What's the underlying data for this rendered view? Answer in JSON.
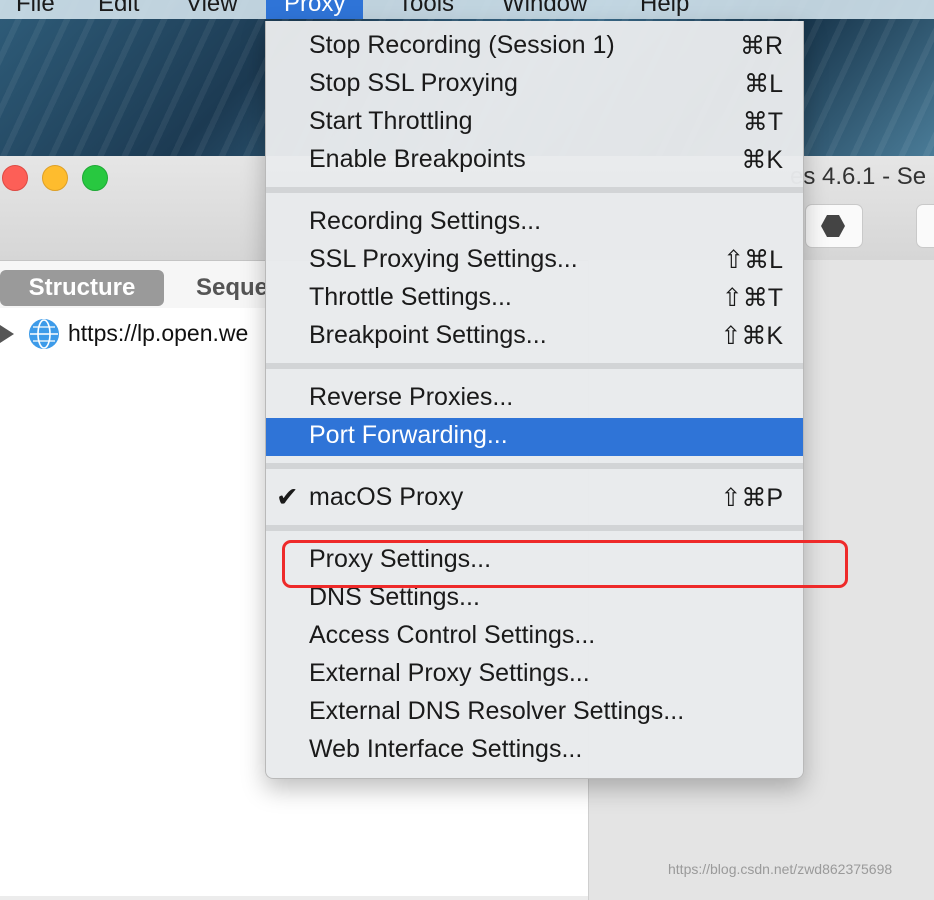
{
  "menubar": {
    "items": [
      "File",
      "Edit",
      "View",
      "Proxy",
      "Tools",
      "Window",
      "Help"
    ],
    "active": "Proxy"
  },
  "window": {
    "title": "es 4.6.1 - Se",
    "tabs": {
      "structure": "Structure",
      "sequence": "Seque"
    },
    "tree": {
      "url": "https://lp.open.we"
    }
  },
  "menu": {
    "sections": [
      [
        {
          "label": "Stop Recording (Session 1)",
          "shortcut": "⌘R"
        },
        {
          "label": "Stop SSL Proxying",
          "shortcut": "⌘L"
        },
        {
          "label": "Start Throttling",
          "shortcut": "⌘T"
        },
        {
          "label": "Enable Breakpoints",
          "shortcut": "⌘K"
        }
      ],
      [
        {
          "label": "Recording Settings...",
          "shortcut": ""
        },
        {
          "label": "SSL Proxying Settings...",
          "shortcut": "⇧⌘L"
        },
        {
          "label": "Throttle Settings...",
          "shortcut": "⇧⌘T"
        },
        {
          "label": "Breakpoint Settings...",
          "shortcut": "⇧⌘K"
        }
      ],
      [
        {
          "label": "Reverse Proxies...",
          "shortcut": ""
        },
        {
          "label": "Port Forwarding...",
          "shortcut": "",
          "highlighted": true
        }
      ],
      [
        {
          "label": "macOS Proxy",
          "shortcut": "⇧⌘P",
          "checked": true,
          "check_mark": "✔"
        }
      ],
      [
        {
          "label": "Proxy Settings...",
          "shortcut": ""
        },
        {
          "label": "DNS Settings...",
          "shortcut": ""
        },
        {
          "label": "Access Control Settings...",
          "shortcut": ""
        },
        {
          "label": "External Proxy Settings...",
          "shortcut": ""
        },
        {
          "label": "External DNS Resolver Settings...",
          "shortcut": ""
        },
        {
          "label": "Web Interface Settings...",
          "shortcut": ""
        }
      ]
    ],
    "highlight_color": "#2f74d7",
    "annotation_color": "#ee2a2a"
  },
  "watermark": "https://blog.csdn.net/zwd862375698"
}
